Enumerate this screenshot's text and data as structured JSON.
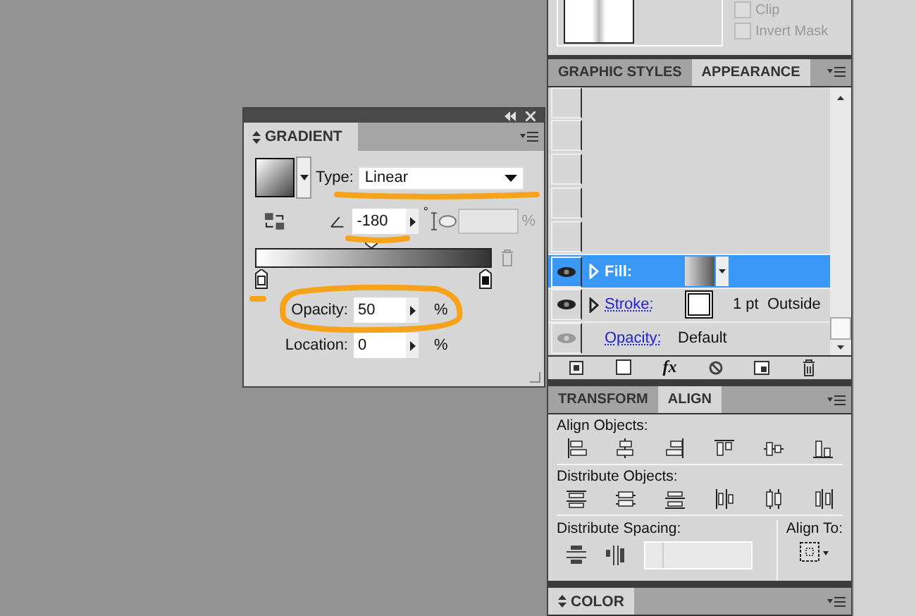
{
  "transparency": {
    "options": [
      {
        "label": "Clip",
        "checked": false
      },
      {
        "label": "Invert Mask",
        "checked": false
      }
    ]
  },
  "gradient_panel": {
    "title": "GRADIENT",
    "type_label": "Type:",
    "type_value": "Linear",
    "angle": "-180",
    "degree_sign": "°",
    "aspect_unit": "%",
    "opacity_label": "Opacity:",
    "opacity": "50",
    "opacity_unit": "%",
    "location_label": "Location:",
    "location": "0",
    "location_unit": "%"
  },
  "appearance_panel": {
    "tabs": [
      {
        "label": "GRAPHIC STYLES",
        "selected": false
      },
      {
        "label": "APPEARANCE",
        "selected": true
      }
    ],
    "rows": [
      {
        "kind": "fill",
        "label": "Fill:",
        "visible": true,
        "selected": true
      },
      {
        "kind": "stroke",
        "label": "Stroke:",
        "value": "1 pt  Outside",
        "visible": true,
        "selected": false
      },
      {
        "kind": "opacity",
        "label": "Opacity:",
        "value": "Default",
        "visible": false,
        "selected": false
      }
    ],
    "fx_label": "fx"
  },
  "align_panel": {
    "tabs": [
      {
        "label": "TRANSFORM",
        "selected": false
      },
      {
        "label": "ALIGN",
        "selected": true
      }
    ],
    "align_objects_label": "Align Objects:",
    "distribute_objects_label": "Distribute Objects:",
    "distribute_spacing_label": "Distribute Spacing:",
    "align_to_label": "Align To:"
  },
  "color_panel": {
    "title": "COLOR"
  }
}
